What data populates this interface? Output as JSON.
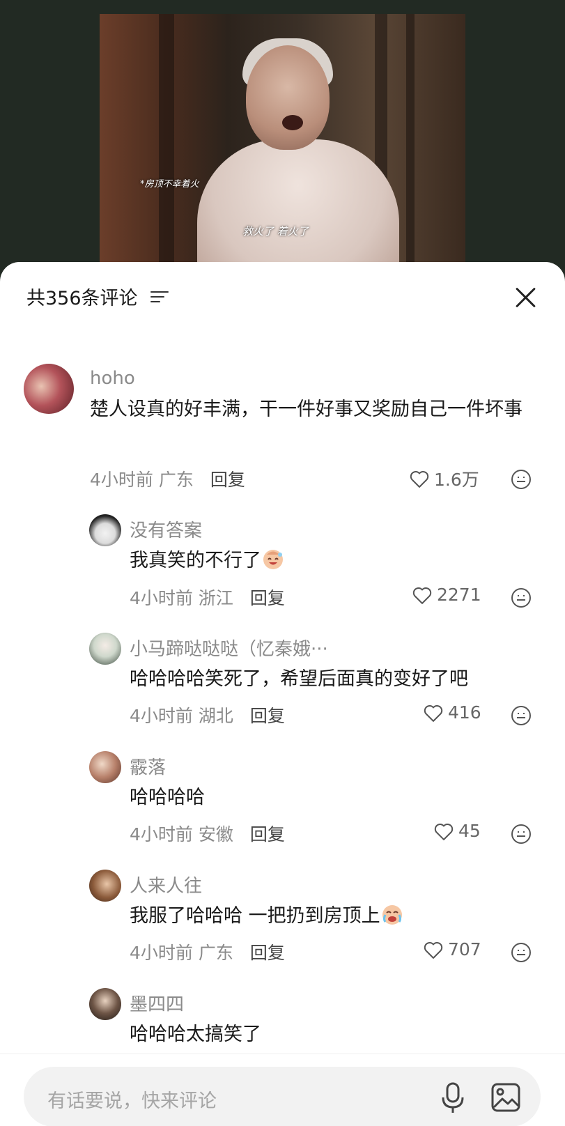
{
  "video": {
    "subtitle_top": "*房顶不幸着火",
    "subtitle_bottom": "救火了 着火了"
  },
  "comments_panel": {
    "title": "共356条评论",
    "filter_icon": "filter-lines-icon",
    "close_icon": "close-x-icon"
  },
  "comments": [
    {
      "username": "hoho",
      "text": "楚人设真的好丰满，干一件好事又奖励自己一件坏事",
      "time": "4小时前",
      "location": "广东",
      "reply_label": "回复",
      "likes": "1.6万"
    },
    {
      "username": "没有答案",
      "text": "我真笑的不行了",
      "emoji": "laughing-face-emoji",
      "time": "4小时前",
      "location": "浙江",
      "reply_label": "回复",
      "likes": "2271"
    },
    {
      "username": "小马蹄哒哒哒（忆秦娥···",
      "text": "哈哈哈哈笑死了，希望后面真的变好了吧",
      "time": "4小时前",
      "location": "湖北",
      "reply_label": "回复",
      "likes": "416"
    },
    {
      "username": "霰落",
      "text": "哈哈哈哈",
      "time": "4小时前",
      "location": "安徽",
      "reply_label": "回复",
      "likes": "45"
    },
    {
      "username": "人来人往",
      "text": "我服了哈哈哈 一把扔到房顶上",
      "emoji": "crying-laughing-emoji",
      "time": "4小时前",
      "location": "广东",
      "reply_label": "回复",
      "likes": "707"
    },
    {
      "username": "墨四四",
      "text": "哈哈哈太搞笑了"
    }
  ],
  "input_bar": {
    "placeholder": "有话要说，快来评论",
    "mic_icon": "microphone-icon",
    "image_icon": "image-icon"
  }
}
